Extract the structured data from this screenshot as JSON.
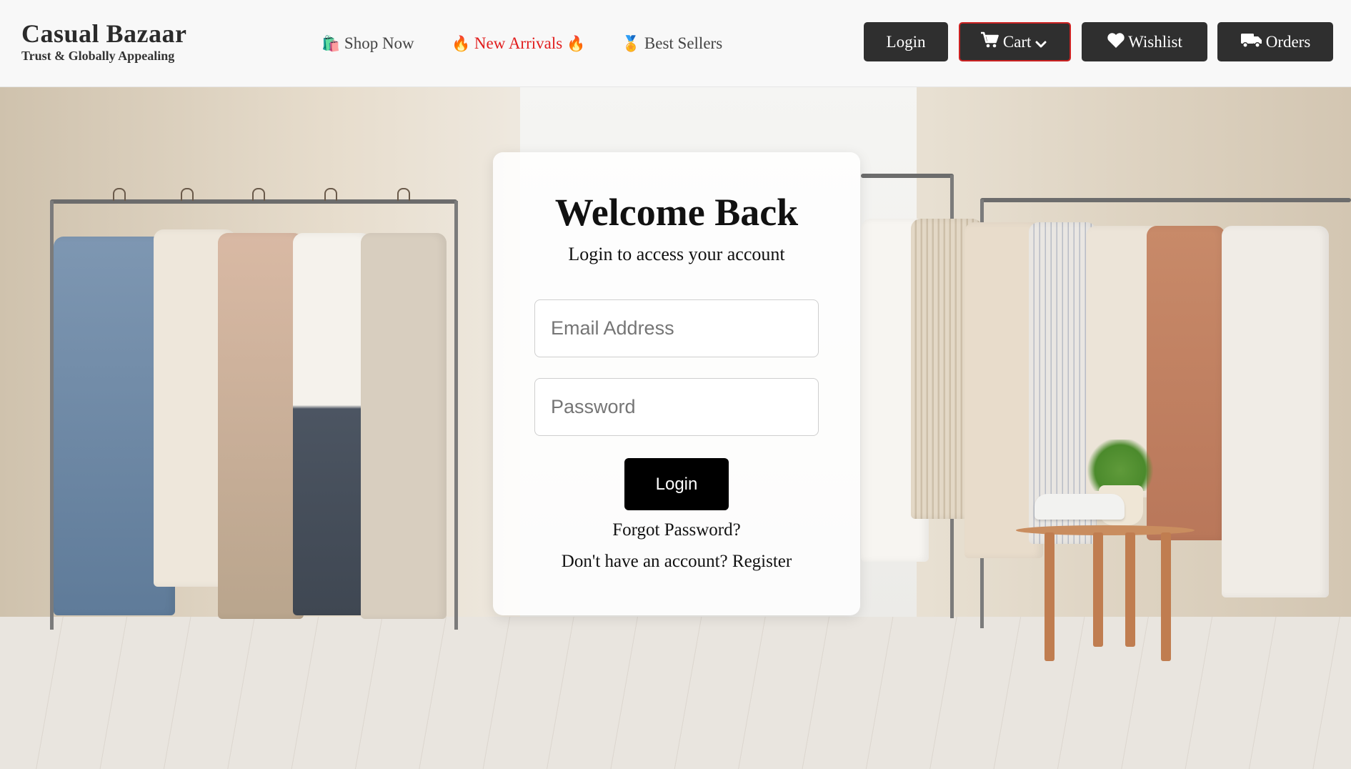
{
  "header": {
    "brand_title": "Casual Bazaar",
    "brand_tagline": "Trust & Globally Appealing",
    "nav": [
      {
        "label": "Shop Now",
        "icon": "shopping-bags-icon",
        "color": "#444444"
      },
      {
        "label": "New Arrivals",
        "icon": "fire-icon",
        "color": "#e11d1d"
      },
      {
        "label": "Best Sellers",
        "icon": "medal-icon",
        "color": "#444444"
      }
    ],
    "buttons": {
      "login": "Login",
      "cart": "Cart",
      "wishlist": "Wishlist",
      "orders": "Orders"
    },
    "icons": {
      "cart": "cart-icon",
      "cart_dropdown": "chevron-down-icon",
      "wishlist": "heart-icon",
      "orders": "truck-icon"
    }
  },
  "login_card": {
    "title": "Welcome Back",
    "subtitle": "Login to access your account",
    "email_placeholder": "Email Address",
    "password_placeholder": "Password",
    "submit_label": "Login",
    "forgot_password": "Forgot Password?",
    "register_prompt": "Don't have an account?",
    "register_link": "Register"
  },
  "colors": {
    "header_bg": "#f8f8f8",
    "button_bg": "#2f2f2f",
    "cart_border": "#cc2222",
    "accent_red": "#e11d1d",
    "submit_bg": "#000000"
  }
}
